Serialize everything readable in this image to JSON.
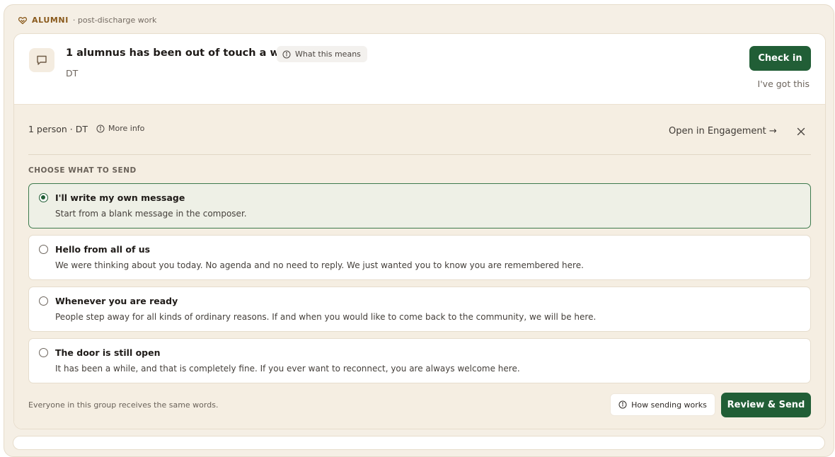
{
  "section": {
    "label": "ALUMNI",
    "sublabel": "· post-discharge work"
  },
  "card": {
    "title": "1 alumnus has been out of touch a while",
    "what_means": "What this means",
    "initials": "DT",
    "check_in_label": "Check in",
    "got_it_label": "I've got this"
  },
  "panel": {
    "people": "1 person · DT",
    "more_info": "More info",
    "open_engagement": "Open in Engagement →",
    "choose_label": "CHOOSE WHAT TO SEND",
    "options": [
      {
        "title": "I'll write my own message",
        "desc": "Start from a blank message in the composer.",
        "selected": true
      },
      {
        "title": "Hello from all of us",
        "desc": "We were thinking about you today. No agenda and no need to reply. We just wanted you to know you are remembered here.",
        "selected": false
      },
      {
        "title": "Whenever you are ready",
        "desc": "People step away for all kinds of ordinary reasons. If and when you would like to come back to the community, we will be here.",
        "selected": false
      },
      {
        "title": "The door is still open",
        "desc": "It has been a while, and that is completely fine. If you ever want to reconnect, you are always welcome here.",
        "selected": false
      }
    ],
    "footer_note": "Everyone in this group receives the same words.",
    "how_sending": "How sending works",
    "review_send": "Review & Send"
  },
  "icons": {
    "section": "heart-hands-icon",
    "card": "chat-bubble-icon",
    "info": "info-circle-icon",
    "close": "close-icon"
  },
  "colors": {
    "accent": "#215e36",
    "panel_bg": "#f5eee2",
    "outer_bg": "#f5efe5",
    "label": "#8a5a1c"
  }
}
